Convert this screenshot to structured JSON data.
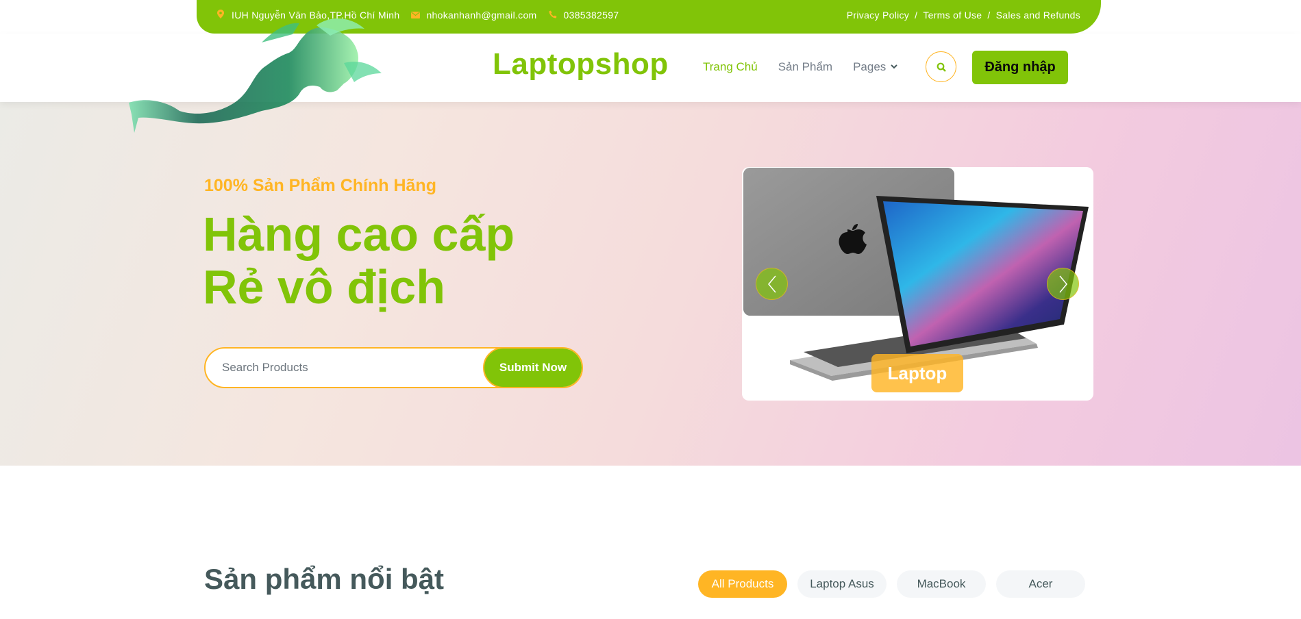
{
  "topbar": {
    "address": "IUH Nguyễn Văn Bảo,TP.Hồ Chí Minh",
    "email": "nhokanhanh@gmail.com",
    "phone": "0385382597",
    "links": [
      "Privacy Policy",
      "Terms of Use",
      "Sales and Refunds"
    ],
    "separator": "/"
  },
  "navbar": {
    "brand": "Laptopshop",
    "items": [
      {
        "label": "Trang Chủ",
        "active": true
      },
      {
        "label": "Sản Phẩm",
        "active": false
      },
      {
        "label": "Pages",
        "active": false
      }
    ],
    "login_label": "Đăng nhập"
  },
  "hero": {
    "subtitle": "100% Sản Phẩm Chính Hãng",
    "title_line1": "Hàng cao cấp",
    "title_line2": "Rẻ vô địch",
    "search_placeholder": "Search Products",
    "submit_label": "Submit Now",
    "carousel": {
      "slide_label": "Laptop"
    }
  },
  "products": {
    "title": "Sản phẩm nổi bật",
    "filters": [
      {
        "label": "All Products",
        "active": true
      },
      {
        "label": "Laptop Asus",
        "active": false
      },
      {
        "label": "MacBook",
        "active": false
      },
      {
        "label": "Acer",
        "active": false
      }
    ]
  },
  "colors": {
    "primary": "#81c408",
    "secondary": "#ffb524",
    "text_dark": "#45595b",
    "text_muted": "#747d88"
  },
  "icons": {
    "address": "map-marker-icon",
    "email": "envelope-icon",
    "phone": "phone-icon",
    "search": "search-icon",
    "dropdown": "chevron-down-icon",
    "prev": "chevron-left-icon",
    "next": "chevron-right-icon"
  }
}
